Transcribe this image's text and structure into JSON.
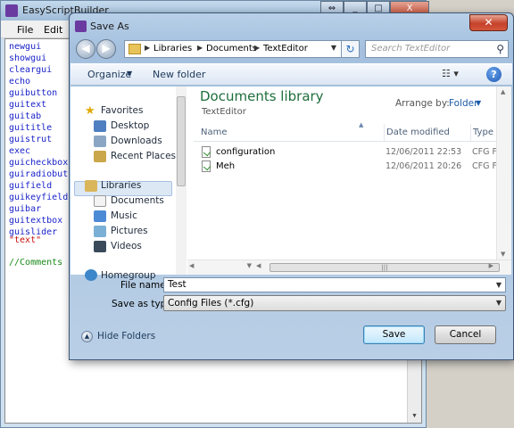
{
  "app": {
    "title": "EasyScriptBuilder",
    "menu": [
      "File",
      "Edit"
    ],
    "window_controls": [
      "⇔",
      "_",
      "□",
      "X"
    ],
    "keywords": [
      "newgui",
      "showgui",
      "cleargui",
      "echo",
      "guibutton",
      "guitext",
      "guitab",
      "guititle",
      "guistrut",
      "exec",
      "guicheckbox",
      "guiradiobutt",
      "guifield",
      "guikeyfield",
      "guibar",
      "guitextbox",
      "guislider"
    ],
    "string_sample": "\"text\"",
    "comment_sample": "//Comments",
    "colors": {
      "keyword": "#1a23c8",
      "string": "#c81010",
      "comment": "#1a8a1a"
    }
  },
  "dialog": {
    "title": "Save As",
    "close": "✕",
    "breadcrumb": [
      "Libraries",
      "Documents",
      "TextEditor"
    ],
    "search_placeholder": "Search TextEditor",
    "toolbar": {
      "organize": "Organize",
      "new_folder": "New folder"
    },
    "nav": {
      "favorites": "Favorites",
      "desktop": "Desktop",
      "downloads": "Downloads",
      "recent": "Recent Places",
      "libraries": "Libraries",
      "documents": "Documents",
      "music": "Music",
      "pictures": "Pictures",
      "videos": "Videos",
      "homegroup": "Homegroup"
    },
    "library": {
      "title": "Documents library",
      "subtitle": "TextEditor",
      "arrange_label": "Arrange by:",
      "arrange_value": "Folder"
    },
    "columns": {
      "name": "Name",
      "date": "Date modified",
      "type": "Type"
    },
    "files": [
      {
        "name": "configuration",
        "date": "12/06/2011 22:53",
        "type": "CFG File"
      },
      {
        "name": "Meh",
        "date": "12/06/2011 20:26",
        "type": "CFG File"
      }
    ],
    "file_name_label": "File name:",
    "file_name_value": "Test",
    "save_type_label": "Save as type:",
    "save_type_value": "Config Files (*.cfg)",
    "hide_folders": "Hide Folders",
    "save": "Save",
    "cancel": "Cancel"
  }
}
